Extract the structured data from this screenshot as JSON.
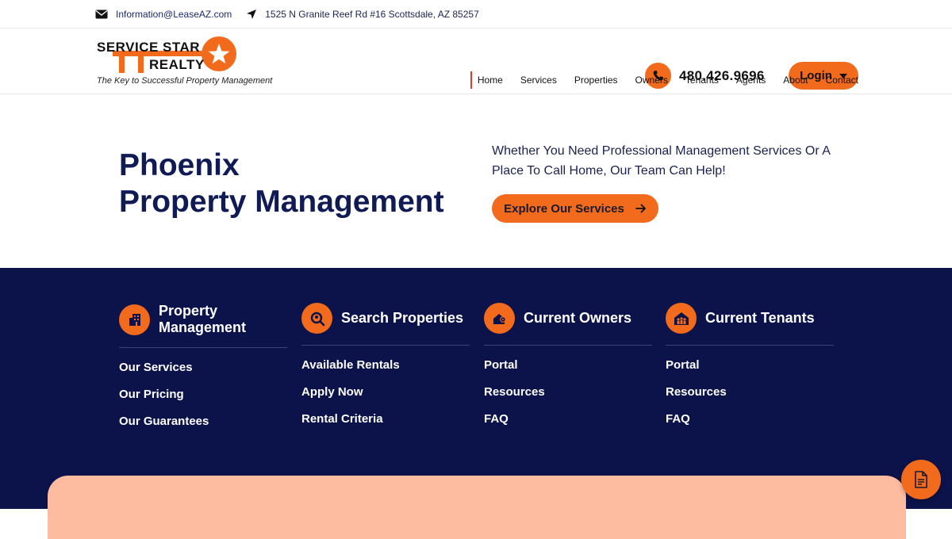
{
  "topbar": {
    "email": "Information@LeaseAZ.com",
    "address": "1525 N Granite Reef Rd #16 Scottsdale, AZ 85257"
  },
  "logo": {
    "line1": "SERVICE STAR",
    "line2": "REALTY",
    "tagline": "The Key to Successful Property Management"
  },
  "header": {
    "phone": "480.426.9696",
    "login_label": "Login"
  },
  "nav": {
    "items": [
      "Home",
      "Services",
      "Properties",
      "Owners",
      "Tenants",
      "Agents",
      "About",
      "Contact"
    ]
  },
  "hero": {
    "title_line1": "Phoenix",
    "title_line2": "Property Management",
    "subtitle": "Whether You Need Professional Management Services Or A Place To Call Home, Our Team Can Help!",
    "cta_label": "Explore Our Services"
  },
  "columns": [
    {
      "title_line1": "Property",
      "title_line2": "Management",
      "icon": "building-icon",
      "links": [
        "Our Services",
        "Our Pricing",
        "Our Guarantees"
      ]
    },
    {
      "title_line1": "Search Properties",
      "title_line2": "",
      "icon": "search-home-icon",
      "links": [
        "Available Rentals",
        "Apply Now",
        "Rental Criteria"
      ]
    },
    {
      "title_line1": "Current Owners",
      "title_line2": "",
      "icon": "house-key-icon",
      "links": [
        "Portal",
        "Resources",
        "FAQ"
      ]
    },
    {
      "title_line1": "Current Tenants",
      "title_line2": "",
      "icon": "tenants-icon",
      "links": [
        "Portal",
        "Resources",
        "FAQ"
      ]
    }
  ],
  "colors": {
    "accent": "#f26a1b",
    "navy": "#0b134a",
    "peach": "#fdbba0"
  },
  "fab": {
    "icon": "document-icon"
  }
}
